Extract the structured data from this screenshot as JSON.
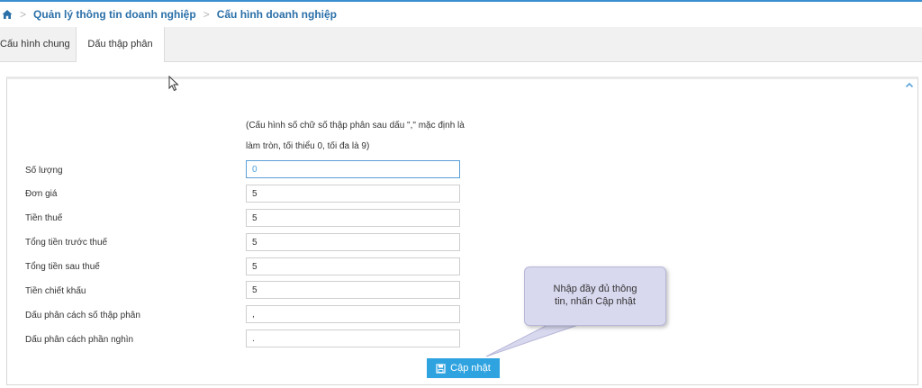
{
  "breadcrumb": {
    "items": [
      "Quản lý thông tin doanh nghiệp",
      "Cấu hình doanh nghiệp"
    ]
  },
  "tabs": [
    {
      "label": "Cấu hình chung",
      "active": false
    },
    {
      "label": "Dấu thập phân",
      "active": true
    }
  ],
  "form": {
    "note_line1": "(Cấu hình số chữ số thập phân sau dấu \",\" mặc định là",
    "note_line2": "làm tròn, tối thiểu 0, tối đa là 9)",
    "fields": [
      {
        "label": "Số lượng",
        "value": "0"
      },
      {
        "label": "Đơn giá",
        "value": "5"
      },
      {
        "label": "Tiền thuế",
        "value": "5"
      },
      {
        "label": "Tổng tiền trước thuế",
        "value": "5"
      },
      {
        "label": "Tổng tiền sau thuế",
        "value": "5"
      },
      {
        "label": "Tiền chiết khấu",
        "value": "5"
      },
      {
        "label": "Dấu phân cách số thập phân",
        "value": ","
      },
      {
        "label": "Dấu phân cách phần nghìn",
        "value": "."
      }
    ],
    "submit_label": "Cập nhật"
  },
  "tooltip": {
    "line1": "Nhập đầy đủ thông",
    "line2": "tin, nhấn Cập nhật"
  },
  "colors": {
    "accent": "#2fa3e0",
    "link": "#2a6fa8",
    "tooltip_bg": "#d8d8ef"
  }
}
